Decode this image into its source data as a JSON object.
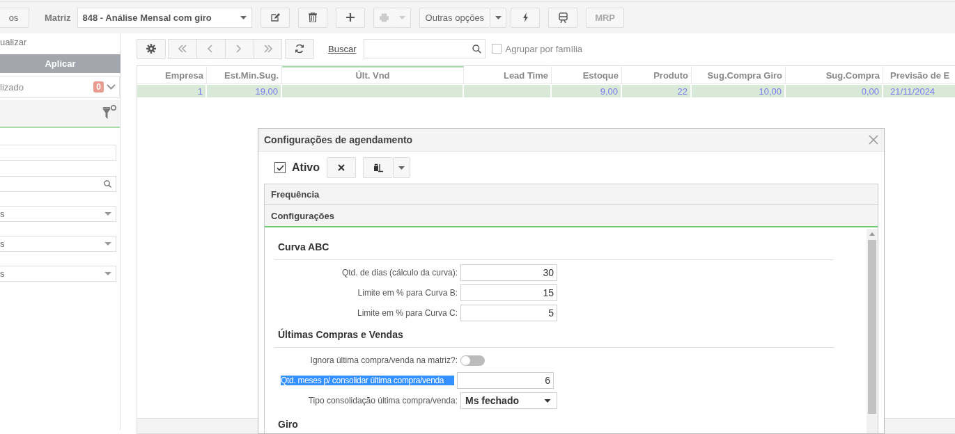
{
  "toolbar": {
    "partial_button": "os",
    "matriz_label": "Matriz",
    "matriz_value": "848 - Análise Mensal com giro",
    "print_disabled": true,
    "other_options": "Outras opções",
    "mrp": {
      "label": "MRP",
      "disabled": true
    }
  },
  "sidebar": {
    "update_link": "ualizar",
    "apply_button": "Aplicar",
    "saved_filter": {
      "label": "lizado",
      "count": "0"
    },
    "fields": [
      {
        "kind": "text"
      },
      {
        "kind": "search"
      },
      {
        "kind": "select",
        "value": "s"
      },
      {
        "kind": "select",
        "value": "s"
      },
      {
        "kind": "select",
        "value": "s"
      }
    ]
  },
  "grid": {
    "search_link": "Buscar",
    "group_by_family": {
      "label": "Agrupar por família",
      "checked": false
    }
  },
  "table": {
    "columns": [
      {
        "label": "Empresa",
        "active": false
      },
      {
        "label": "Est.Min.Sug.",
        "active": false
      },
      {
        "label": "Últ. Vnd",
        "active": true
      },
      {
        "label": "Lead Time",
        "active": false
      },
      {
        "label": "Estoque",
        "active": false
      },
      {
        "label": "Produto",
        "active": false
      },
      {
        "label": "Sug.Compra Giro",
        "active": false
      },
      {
        "label": "Sug.Compra",
        "active": false
      },
      {
        "label": "Previsão de E",
        "active": false
      }
    ],
    "rows": [
      {
        "selected": true,
        "cells": [
          "1",
          "19,00",
          null,
          null,
          "9,00",
          "22",
          "10,00",
          "0,00",
          "21/11/2024"
        ]
      }
    ]
  },
  "dialog": {
    "title": "Configurações de agendamento",
    "active": {
      "label": "Ativo",
      "checked": true
    },
    "sections": [
      {
        "label": "Frequência",
        "expanded": false
      },
      {
        "label": "Configurações",
        "expanded": true
      }
    ],
    "groups": [
      {
        "title": "Curva ABC",
        "fields": [
          {
            "kind": "number",
            "label": "Qtd. de dias (cálculo da curva):",
            "value": "30",
            "highlighted": false
          },
          {
            "kind": "number",
            "label": "Limite em % para Curva B:",
            "value": "15",
            "highlighted": false
          },
          {
            "kind": "number",
            "label": "Limite em % para Curva C:",
            "value": "5",
            "highlighted": false
          }
        ]
      },
      {
        "title": "Últimas Compras e Vendas",
        "fields": [
          {
            "kind": "toggle",
            "label": "Ignora última compra/venda na matriz?:",
            "on": false,
            "highlighted": false
          },
          {
            "kind": "number",
            "label": "Qtd. meses p/ consolidar última compra/venda",
            "value": "6",
            "highlighted": true
          },
          {
            "kind": "select",
            "label": "Tipo consolidação última compra/venda:",
            "value": "Ms fechado",
            "highlighted": false
          }
        ]
      },
      {
        "title": "Giro"
      }
    ]
  }
}
